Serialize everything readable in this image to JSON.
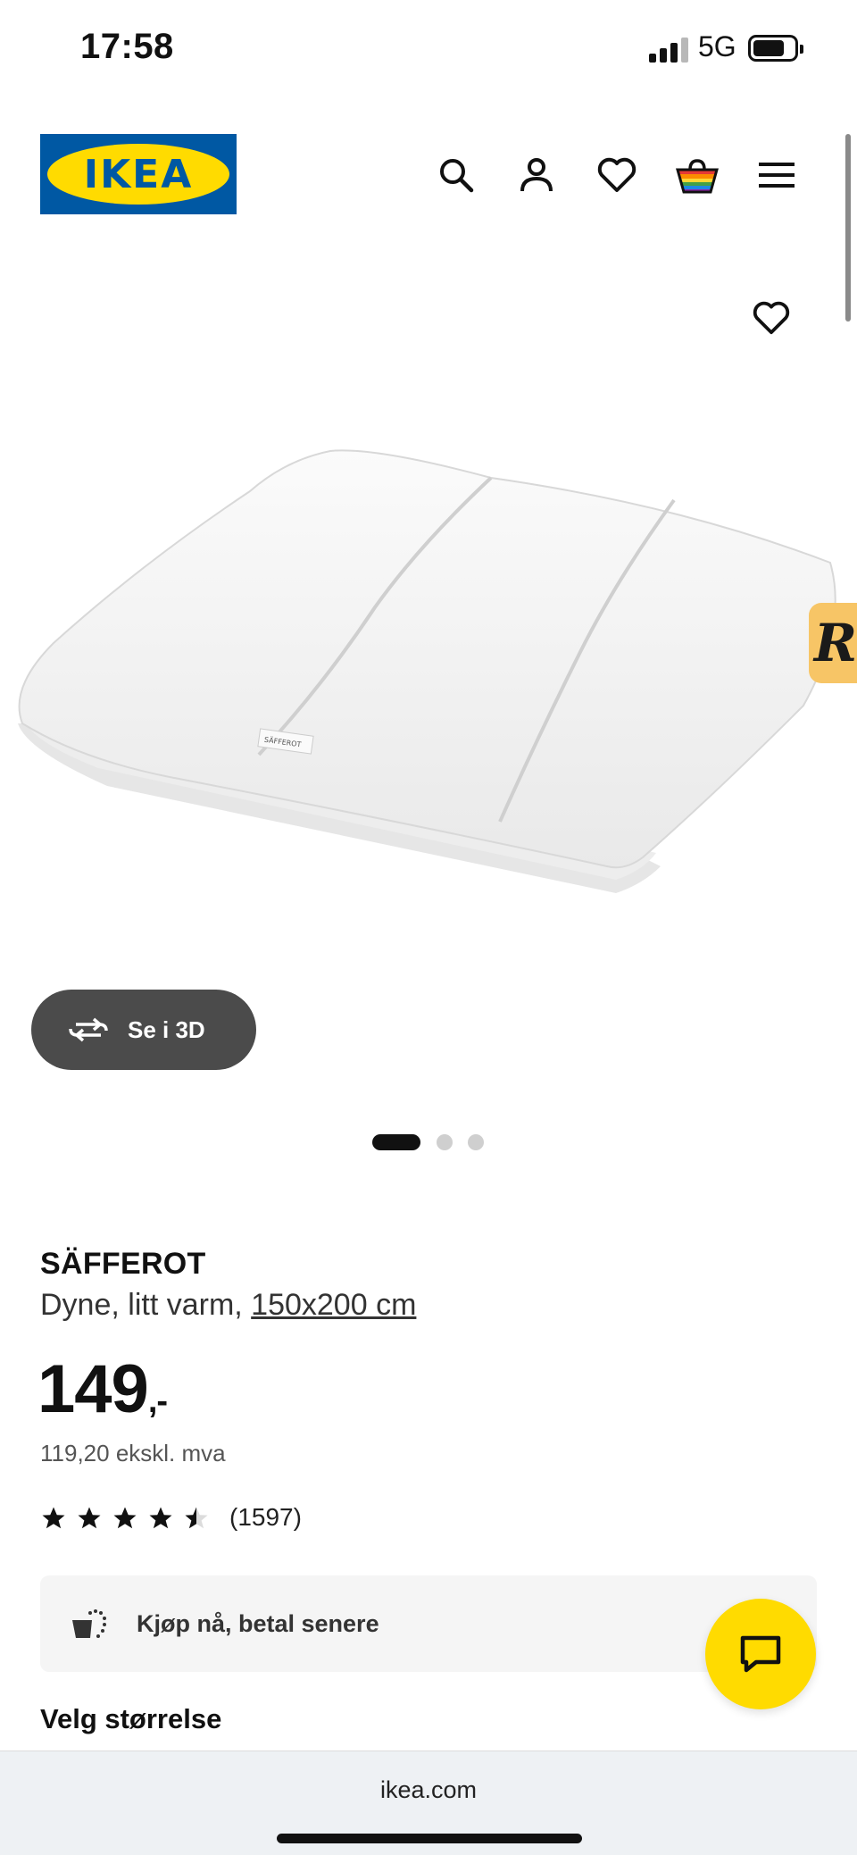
{
  "status_bar": {
    "time": "17:58",
    "network": "5G"
  },
  "header": {
    "logo_text": "IKEA",
    "icons": [
      "search-icon",
      "account-icon",
      "heart-icon",
      "shopping-bag-icon",
      "menu-icon"
    ]
  },
  "media": {
    "view_3d_label": "Se i 3D",
    "image_count": 3,
    "active_image": 1
  },
  "product": {
    "name": "SÄFFEROT",
    "description": "Dyne, litt varm, ",
    "size_link": "150x200 cm",
    "price_main": "149",
    "price_suffix": ",-",
    "price_ex_vat": "119,20 ekskl. mva",
    "rating": 4.5,
    "review_count": "(1597)"
  },
  "payment": {
    "label": "Kjøp nå, betal senere"
  },
  "section": {
    "choose_size": "Velg størrelse"
  },
  "browser": {
    "url": "ikea.com"
  },
  "colors": {
    "ikea_blue": "#0058a3",
    "ikea_yellow": "#ffdb00",
    "badge_yellow": "#f7c566",
    "dark_button": "#4b4b4b"
  }
}
